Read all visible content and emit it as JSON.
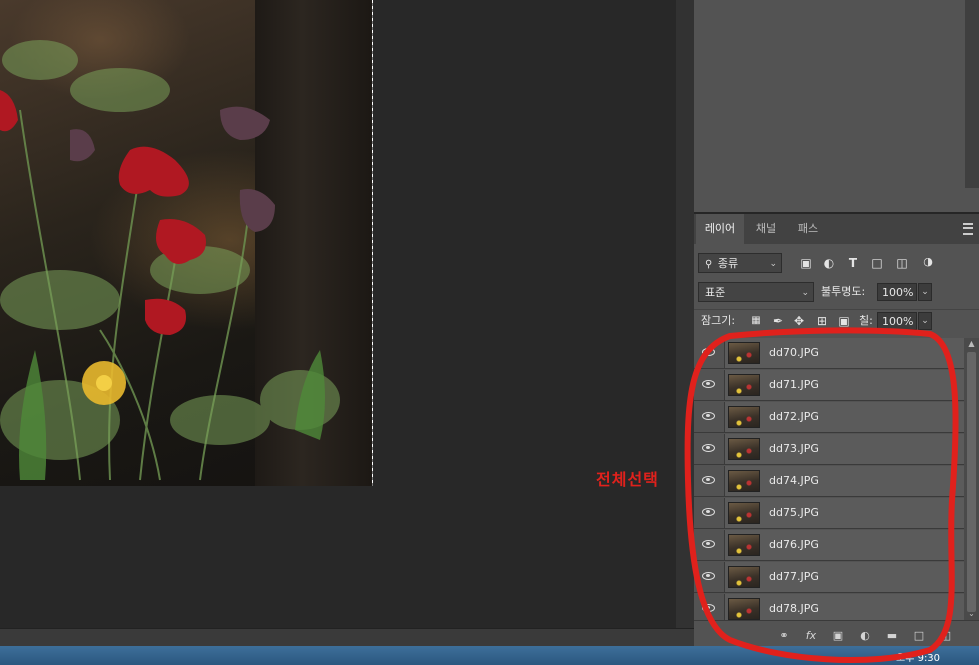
{
  "layers_panel": {
    "tabs": [
      {
        "label": "레이어",
        "active": true
      },
      {
        "label": "채널",
        "active": false
      },
      {
        "label": "패스",
        "active": false
      }
    ],
    "filter": {
      "kind_label": "종류",
      "icons": [
        "image-filter-icon",
        "adjustment-filter-icon",
        "type-filter-icon",
        "shape-filter-icon",
        "smart-object-filter-icon",
        "filter-toggle-icon"
      ]
    },
    "blend_mode": "표준",
    "opacity_label": "불투명도:",
    "opacity_value": "100%",
    "lock_label": "잠그기:",
    "fill_label": "칠:",
    "fill_value": "100%",
    "layers": [
      {
        "name": "dd70.JPG",
        "visible": true
      },
      {
        "name": "dd71.JPG",
        "visible": true
      },
      {
        "name": "dd72.JPG",
        "visible": true
      },
      {
        "name": "dd73.JPG",
        "visible": true
      },
      {
        "name": "dd74.JPG",
        "visible": true
      },
      {
        "name": "dd75.JPG",
        "visible": true
      },
      {
        "name": "dd76.JPG",
        "visible": true
      },
      {
        "name": "dd77.JPG",
        "visible": true
      },
      {
        "name": "dd78.JPG",
        "visible": true
      }
    ],
    "bottom_icons": [
      "link-icon",
      "fx-icon",
      "mask-icon",
      "adjustment-icon",
      "folder-icon",
      "new-layer-icon",
      "trash-icon"
    ]
  },
  "annotation": {
    "text": "전체선택",
    "color": "#e0211c"
  },
  "taskbar": {
    "clock": "오후 9:30"
  },
  "colors": {
    "panel_bg": "#535353",
    "workspace_bg": "#282828",
    "annotation_red": "#e0211c"
  }
}
